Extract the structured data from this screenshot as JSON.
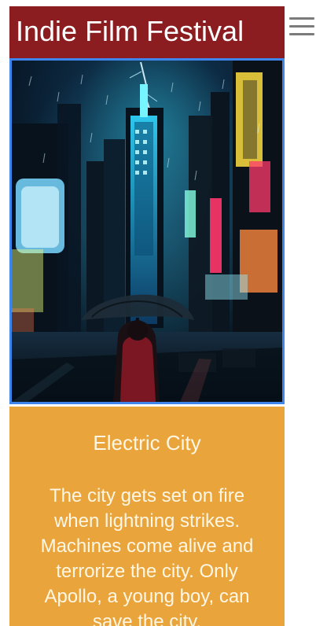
{
  "header": {
    "title": "Indie Film Festival",
    "menu_icon": "hamburger-menu-icon"
  },
  "poster": {
    "image_desc_icon": "rainy-neon-city-poster"
  },
  "film": {
    "title": "Electric City",
    "description": "The city gets set on fire when lightning strikes. Machines come alive and terrorize the city. Only Apollo, a young boy, can save the city."
  },
  "colors": {
    "header_bg": "#8b1c1f",
    "info_bg": "#e9a43c",
    "poster_border": "#3f86ec",
    "menu_icon": "#7b7b7b"
  }
}
